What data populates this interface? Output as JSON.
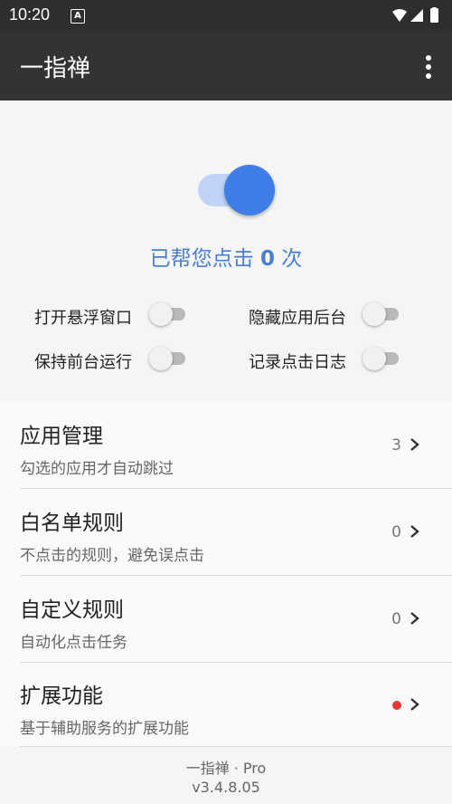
{
  "status_bar": {
    "time": "10:20",
    "app_icon_letter": "A"
  },
  "app_bar": {
    "title": "一指禅"
  },
  "main_switch": {
    "state": "on",
    "accent": "#3e7ee6"
  },
  "counter": {
    "prefix": "已帮您点击 ",
    "count": "0",
    "suffix": " 次"
  },
  "options": [
    {
      "label": "打开悬浮窗口",
      "on": false
    },
    {
      "label": "隐藏应用后台",
      "on": false
    },
    {
      "label": "保持前台运行",
      "on": false
    },
    {
      "label": "记录点击日志",
      "on": false
    }
  ],
  "list": [
    {
      "title": "应用管理",
      "subtitle": "勾选的应用才自动跳过",
      "value": "3"
    },
    {
      "title": "白名单规则",
      "subtitle": "不点击的规则，避免误点击",
      "value": "0"
    },
    {
      "title": "自定义规则",
      "subtitle": "自动化点击任务",
      "value": "0"
    },
    {
      "title": "扩展功能",
      "subtitle": "基于辅助服务的扩展功能",
      "badge_color": "#e53935"
    }
  ],
  "footer": {
    "line1": "一指禅 · Pro",
    "line2": "v3.4.8.05"
  }
}
